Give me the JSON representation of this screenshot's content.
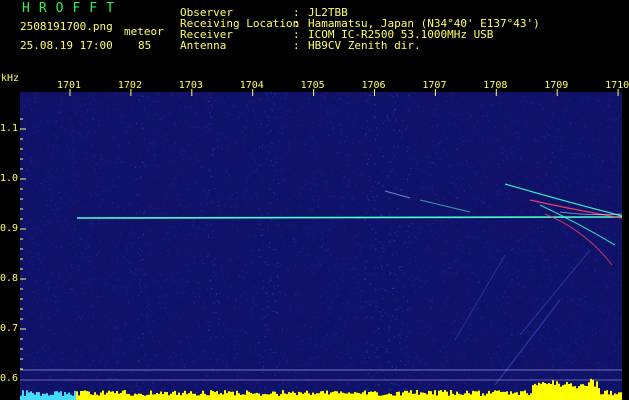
{
  "app": {
    "brand": "HROFFT",
    "filename": "2508191700.png",
    "timestamp": "25.08.19 17:00",
    "meteor_label": "meteor",
    "meteor_count": "85"
  },
  "info": {
    "labels": [
      "Observer",
      "Receiving Location",
      "Receiver",
      "Antenna"
    ],
    "sep": ":",
    "values": [
      "JL2TBB",
      "Hamamatsu, Japan (N34°40' E137°43')",
      "ICOM IC-R2500 53.1000MHz USB",
      "HB9CV Zenith dir."
    ]
  },
  "axes": {
    "unit": "kHz",
    "y_ticks": [
      "1.1",
      "1.0",
      "0.9",
      "0.8",
      "0.7",
      "0.6"
    ],
    "x_ticks": [
      "1701",
      "1702",
      "1703",
      "1704",
      "1705",
      "1706",
      "1707",
      "1708",
      "1709",
      "1710"
    ]
  },
  "colors": {
    "background": "#10126a",
    "noise": "#2a44dd",
    "signal": "#44ffcc",
    "meteor": "#ff4466",
    "level": "#ffff00",
    "text": "#ffff66",
    "brand": "#33ee55"
  }
}
